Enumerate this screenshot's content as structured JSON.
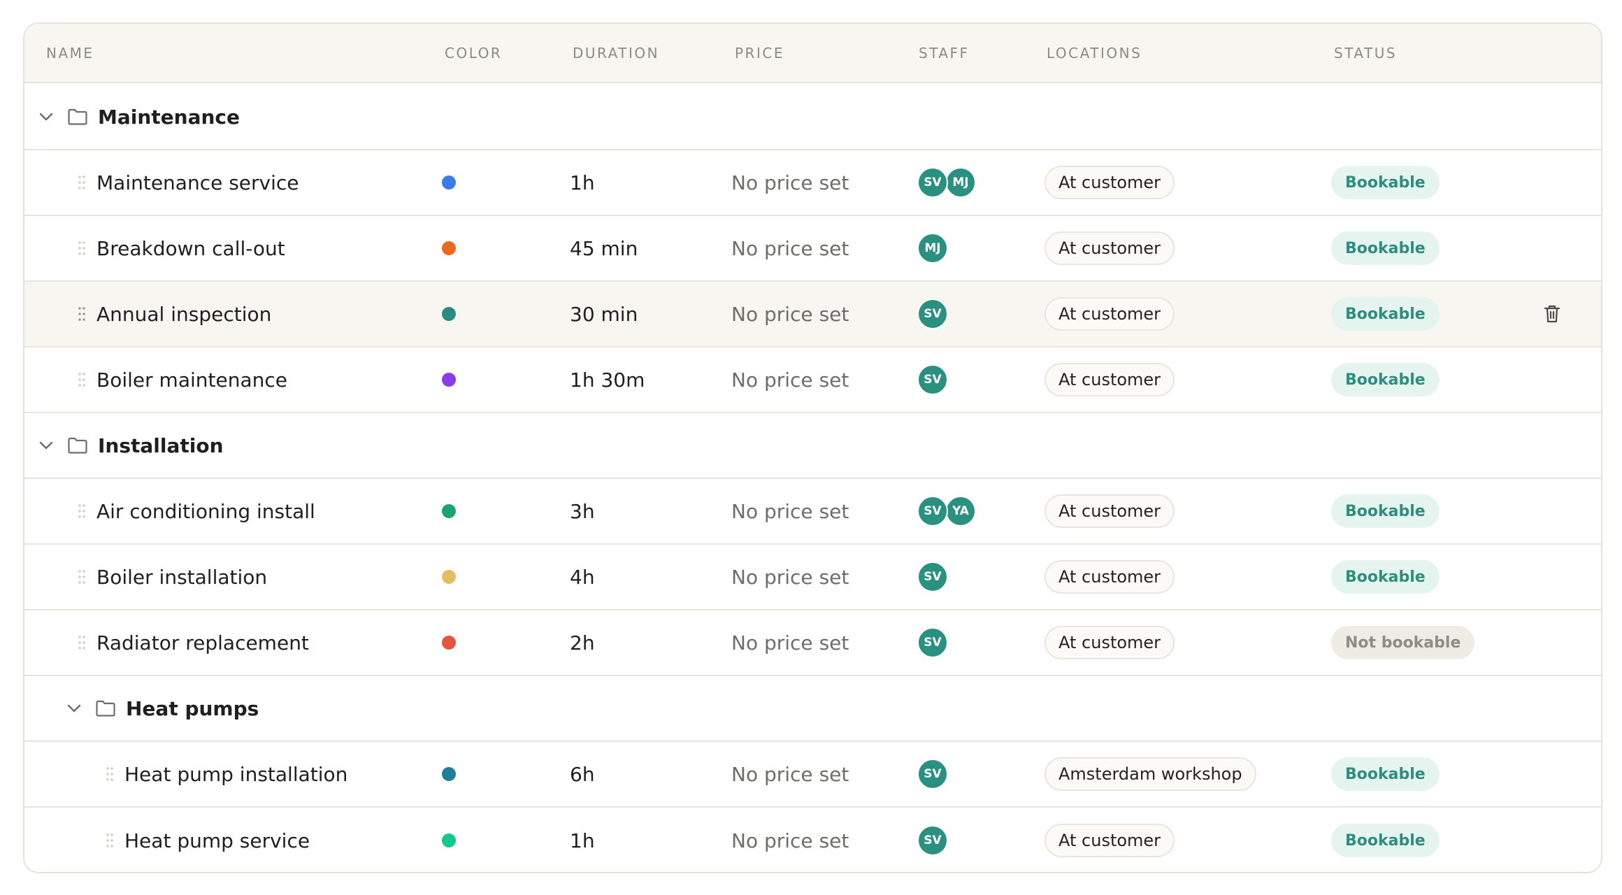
{
  "columns": {
    "name": "NAME",
    "color": "COLOR",
    "duration": "DURATION",
    "price": "PRICE",
    "staff": "STAFF",
    "locations": "LOCATIONS",
    "status": "STATUS"
  },
  "colors": {
    "avatar": "#2a9080",
    "bookable_bg": "#e6f4f0",
    "bookable_text": "#2e8e7d",
    "not_bookable_bg": "#efece6",
    "not_bookable_text": "#8f8c86"
  },
  "rows": [
    {
      "type": "group",
      "label": "Maintenance"
    },
    {
      "type": "item",
      "name": "Maintenance service",
      "color": "#3b7be8",
      "duration": "1h",
      "price": "No price set",
      "staff": [
        "SV",
        "MJ"
      ],
      "location": "At customer",
      "status": "Bookable"
    },
    {
      "type": "item",
      "name": "Breakdown call-out",
      "color": "#ec6a1e",
      "duration": "45 min",
      "price": "No price set",
      "staff": [
        "MJ"
      ],
      "location": "At customer",
      "status": "Bookable"
    },
    {
      "type": "item",
      "name": "Annual inspection",
      "color": "#2a8c80",
      "duration": "30 min",
      "price": "No price set",
      "staff": [
        "SV"
      ],
      "location": "At customer",
      "status": "Bookable"
    },
    {
      "type": "item",
      "name": "Boiler maintenance",
      "color": "#8a3de8",
      "duration": "1h 30m",
      "price": "No price set",
      "staff": [
        "SV"
      ],
      "location": "At customer",
      "status": "Bookable"
    },
    {
      "type": "group",
      "label": "Installation"
    },
    {
      "type": "item",
      "name": "Air conditioning install",
      "color": "#1aa56f",
      "duration": "3h",
      "price": "No price set",
      "staff": [
        "SV",
        "YA"
      ],
      "location": "At customer",
      "status": "Bookable"
    },
    {
      "type": "item",
      "name": "Boiler installation",
      "color": "#e3bd62",
      "duration": "4h",
      "price": "No price set",
      "staff": [
        "SV"
      ],
      "location": "At customer",
      "status": "Bookable"
    },
    {
      "type": "item",
      "name": "Radiator replacement",
      "color": "#e2563f",
      "duration": "2h",
      "price": "No price set",
      "staff": [
        "SV"
      ],
      "location": "At customer",
      "status": "Not bookable"
    },
    {
      "type": "subgroup",
      "label": "Heat pumps"
    },
    {
      "type": "subitem",
      "name": "Heat pump installation",
      "color": "#1f7f9a",
      "duration": "6h",
      "price": "No price set",
      "staff": [
        "SV"
      ],
      "location": "Amsterdam workshop",
      "status": "Bookable"
    },
    {
      "type": "subitem",
      "name": "Heat pump service",
      "color": "#15c98e",
      "duration": "1h",
      "price": "No price set",
      "staff": [
        "SV"
      ],
      "location": "At customer",
      "status": "Bookable"
    }
  ]
}
